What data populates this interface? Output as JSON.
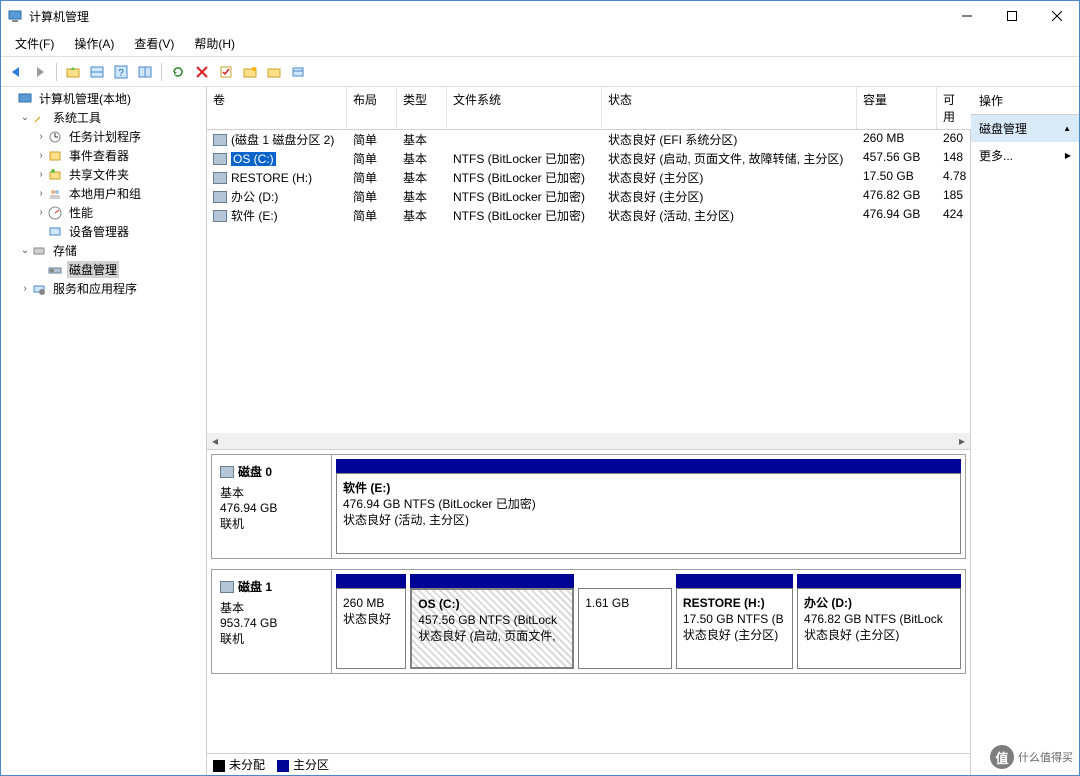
{
  "window": {
    "title": "计算机管理"
  },
  "menu": [
    "文件(F)",
    "操作(A)",
    "查看(V)",
    "帮助(H)"
  ],
  "tree": {
    "root": "计算机管理(本地)",
    "systools": "系统工具",
    "systools_children": [
      "任务计划程序",
      "事件查看器",
      "共享文件夹",
      "本地用户和组",
      "性能",
      "设备管理器"
    ],
    "storage": "存储",
    "diskmgmt": "磁盘管理",
    "services": "服务和应用程序"
  },
  "columns": {
    "vol": "卷",
    "layout": "布局",
    "type": "类型",
    "fs": "文件系统",
    "status": "状态",
    "capacity": "容量",
    "free": "可用"
  },
  "volumes": [
    {
      "name": "(磁盘 1 磁盘分区 2)",
      "layout": "简单",
      "type": "基本",
      "fs": "",
      "status": "状态良好 (EFI 系统分区)",
      "capacity": "260 MB",
      "free": "260"
    },
    {
      "name": "OS (C:)",
      "layout": "简单",
      "type": "基本",
      "fs": "NTFS (BitLocker 已加密)",
      "status": "状态良好 (启动, 页面文件, 故障转储, 主分区)",
      "capacity": "457.56 GB",
      "free": "148",
      "selected": true
    },
    {
      "name": "RESTORE (H:)",
      "layout": "简单",
      "type": "基本",
      "fs": "NTFS (BitLocker 已加密)",
      "status": "状态良好 (主分区)",
      "capacity": "17.50 GB",
      "free": "4.78"
    },
    {
      "name": "办公 (D:)",
      "layout": "简单",
      "type": "基本",
      "fs": "NTFS (BitLocker 已加密)",
      "status": "状态良好 (主分区)",
      "capacity": "476.82 GB",
      "free": "185"
    },
    {
      "name": "软件 (E:)",
      "layout": "简单",
      "type": "基本",
      "fs": "NTFS (BitLocker 已加密)",
      "status": "状态良好 (活动, 主分区)",
      "capacity": "476.94 GB",
      "free": "424"
    }
  ],
  "disks": [
    {
      "name": "磁盘 0",
      "type": "基本",
      "size": "476.94 GB",
      "state": "联机",
      "parts": [
        {
          "title": "软件  (E:)",
          "line2": "476.94 GB NTFS (BitLocker 已加密)",
          "line3": "状态良好 (活动, 主分区)",
          "flex": 1,
          "header": true
        }
      ]
    },
    {
      "name": "磁盘 1",
      "type": "基本",
      "size": "953.74 GB",
      "state": "联机",
      "parts": [
        {
          "title": "",
          "line2": "260 MB",
          "line3": "状态良好",
          "flex": 0.6,
          "header": true
        },
        {
          "title": "OS  (C:)",
          "line2": "457.56 GB NTFS (BitLock",
          "line3": "状态良好 (启动, 页面文件,",
          "flex": 1.4,
          "header": true,
          "hatched": true
        },
        {
          "title": "",
          "line2": "1.61 GB",
          "line3": "",
          "flex": 0.8,
          "header": false
        },
        {
          "title": "RESTORE  (H:)",
          "line2": "17.50 GB NTFS (B",
          "line3": "状态良好 (主分区)",
          "flex": 1.0,
          "header": true
        },
        {
          "title": "办公  (D:)",
          "line2": "476.82 GB NTFS (BitLock",
          "line3": "状态良好 (主分区)",
          "flex": 1.4,
          "header": true
        }
      ]
    }
  ],
  "legend": {
    "unalloc": "未分配",
    "primary": "主分区"
  },
  "actions": {
    "header": "操作",
    "item1": "磁盘管理",
    "item2": "更多..."
  },
  "watermark": "什么值得买"
}
